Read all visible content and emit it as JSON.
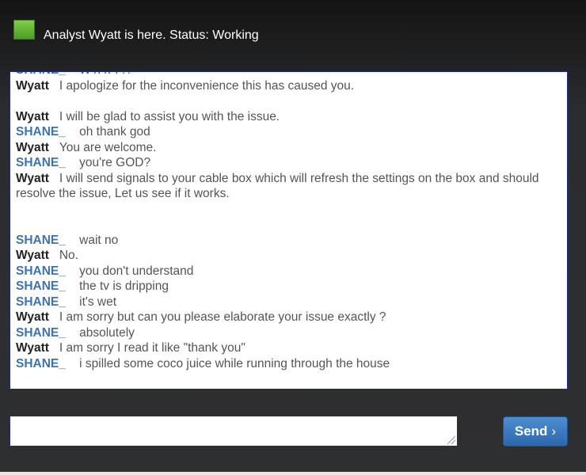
{
  "header": {
    "status_text": "Analyst Wyatt is here. Status: Working",
    "status_color": "#5fb333"
  },
  "chat": {
    "messages": [
      {
        "sender": "SHANE_",
        "role": "customer",
        "text": "WYATT?!"
      },
      {
        "sender": "Wyatt",
        "role": "agent",
        "text": "I apologize for the inconvenience this has caused you."
      },
      {
        "gap": 1
      },
      {
        "sender": "Wyatt",
        "role": "agent",
        "text": "I will be glad to assist you with the issue."
      },
      {
        "sender": "SHANE_",
        "role": "customer",
        "text": "oh thank god"
      },
      {
        "sender": "Wyatt",
        "role": "agent",
        "text": "You are welcome."
      },
      {
        "sender": "SHANE_",
        "role": "customer",
        "text": "you're GOD?"
      },
      {
        "sender": "Wyatt",
        "role": "agent",
        "text": "I will send signals to your cable box which will refresh the settings on the box and should resolve the issue, Let us see if it works."
      },
      {
        "gap": 2
      },
      {
        "sender": "SHANE_",
        "role": "customer",
        "text": "wait no"
      },
      {
        "sender": "Wyatt",
        "role": "agent",
        "text": "No."
      },
      {
        "sender": "SHANE_",
        "role": "customer",
        "text": "you don't understand"
      },
      {
        "sender": "SHANE_",
        "role": "customer",
        "text": "the tv is dripping"
      },
      {
        "sender": "SHANE_",
        "role": "customer",
        "text": "it's wet"
      },
      {
        "sender": "Wyatt",
        "role": "agent",
        "text": "I am sorry but can you please elaborate your issue exactly ?"
      },
      {
        "sender": "SHANE_",
        "role": "customer",
        "text": "absolutely"
      },
      {
        "sender": "Wyatt",
        "role": "agent",
        "text": "I am sorry I read it like \"thank you\""
      },
      {
        "sender": "SHANE_",
        "role": "customer",
        "text": "i spilled some coco juice while running through the house"
      }
    ]
  },
  "composer": {
    "input_value": "",
    "send_label": "Send",
    "send_icon": "chevron-right-icon",
    "accent": "#2f6db3"
  }
}
